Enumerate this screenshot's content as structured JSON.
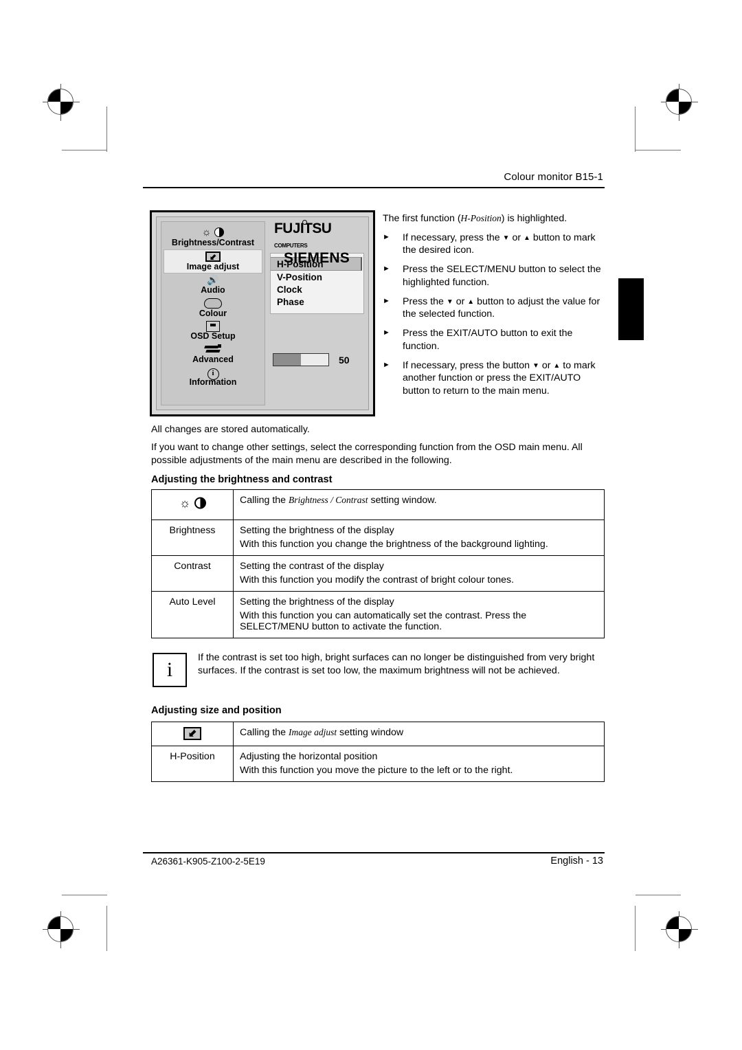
{
  "header": {
    "title": "Colour monitor B15-1"
  },
  "footer": {
    "doc_number": "A26361-K905-Z100-2-5E19",
    "page_label": "English - 13"
  },
  "osd_figure": {
    "menu_items": [
      {
        "icon": "brightness-contrast-icon",
        "label": "Brightness/Contrast",
        "selected": false
      },
      {
        "icon": "image-adjust-icon",
        "label": "Image adjust",
        "selected": true
      },
      {
        "icon": "audio-speaker-icon",
        "label": "Audio",
        "selected": false
      },
      {
        "icon": "colour-palette-icon",
        "label": "Colour",
        "selected": false
      },
      {
        "icon": "osd-setup-screen-icon",
        "label": "OSD Setup",
        "selected": false
      },
      {
        "icon": "advanced-tools-icon",
        "label": "Advanced",
        "selected": false
      },
      {
        "icon": "information-icon",
        "label": "Information",
        "selected": false
      }
    ],
    "logo": {
      "line1": "FUJITSU",
      "superscript": "COMPUTERS",
      "line2": "SIEMENS"
    },
    "submenu_items": [
      {
        "label": "H-Position",
        "highlighted": true
      },
      {
        "label": "V-Position",
        "highlighted": false
      },
      {
        "label": "Clock",
        "highlighted": false
      },
      {
        "label": "Phase",
        "highlighted": false
      }
    ],
    "slider": {
      "value": "50",
      "fill_percent": 50
    }
  },
  "instructions": {
    "intro_before": "The first function (",
    "intro_italic": "H-Position",
    "intro_after": ") is highlighted.",
    "bullet_marker": "►",
    "down_arrow": "▼",
    "up_arrow": "▲",
    "steps": [
      {
        "parts": [
          "If necessary, press the ",
          "▼",
          " or ",
          "▲",
          " button to mark the desired icon."
        ]
      },
      {
        "parts": [
          "Press the SELECT/MENU button to select the highlighted function."
        ]
      },
      {
        "parts": [
          "Press the ",
          "▼",
          " or ",
          "▲",
          " button to adjust the value for the selected function."
        ]
      },
      {
        "parts": [
          "Press the EXIT/AUTO button to exit the function."
        ]
      },
      {
        "parts": [
          "If necessary, press the button ",
          "▼",
          " or ",
          "▲",
          " to mark another function or press the EXIT/AUTO button to return to the main menu."
        ]
      }
    ]
  },
  "body": {
    "auto_store": "All changes are stored automatically.",
    "change_settings": "If you want to change other settings, select the corresponding function from the OSD main menu. All possible adjustments of the main menu are described in the following.",
    "heading_brightness": "Adjusting the brightness and contrast",
    "heading_size": "Adjusting size and position"
  },
  "brightness_table": {
    "rows": [
      {
        "label_icon": "brightness-contrast-icon",
        "label": "",
        "lines": [
          "Calling the Brightness / Contrast setting window."
        ],
        "italic_part": "Brightness / Contrast",
        "pre": "Calling the ",
        "post": " setting window."
      },
      {
        "label": "Brightness",
        "lines": [
          "Setting the brightness of the display",
          "With this function you change the brightness of the background lighting."
        ]
      },
      {
        "label": "Contrast",
        "lines": [
          "Setting the contrast of the display",
          "With this function you modify the contrast of bright colour tones."
        ]
      },
      {
        "label": "Auto Level",
        "lines": [
          "Setting the brightness of the display",
          "With this function you can automatically set the contrast. Press the SELECT/MENU button to activate the function."
        ]
      }
    ]
  },
  "note": {
    "icon": "information-i-icon",
    "symbol": "i",
    "text": "If the contrast is set too high, bright surfaces can no longer be distinguished from very bright surfaces. If the contrast is set too low, the maximum brightness will not be achieved."
  },
  "size_table": {
    "rows": [
      {
        "label_icon": "image-adjust-icon",
        "label": "",
        "pre": "Calling the ",
        "italic_part": "Image adjust",
        "post": " setting window"
      },
      {
        "label": "H-Position",
        "lines": [
          "Adjusting the horizontal position",
          "With this function you move the picture to the left or to the right."
        ]
      }
    ]
  },
  "colors": {
    "page_background": "#ffffff",
    "text": "#000000",
    "osd_panel": "#cfcfcf",
    "osd_left_panel": "#c8c8c8",
    "osd_selected": "#ececec",
    "osd_list_bg": "#f2f2f2",
    "osd_highlight": "#bdbdbd",
    "slider_fill": "#8d8d8d",
    "thumb_index": "#000000"
  }
}
